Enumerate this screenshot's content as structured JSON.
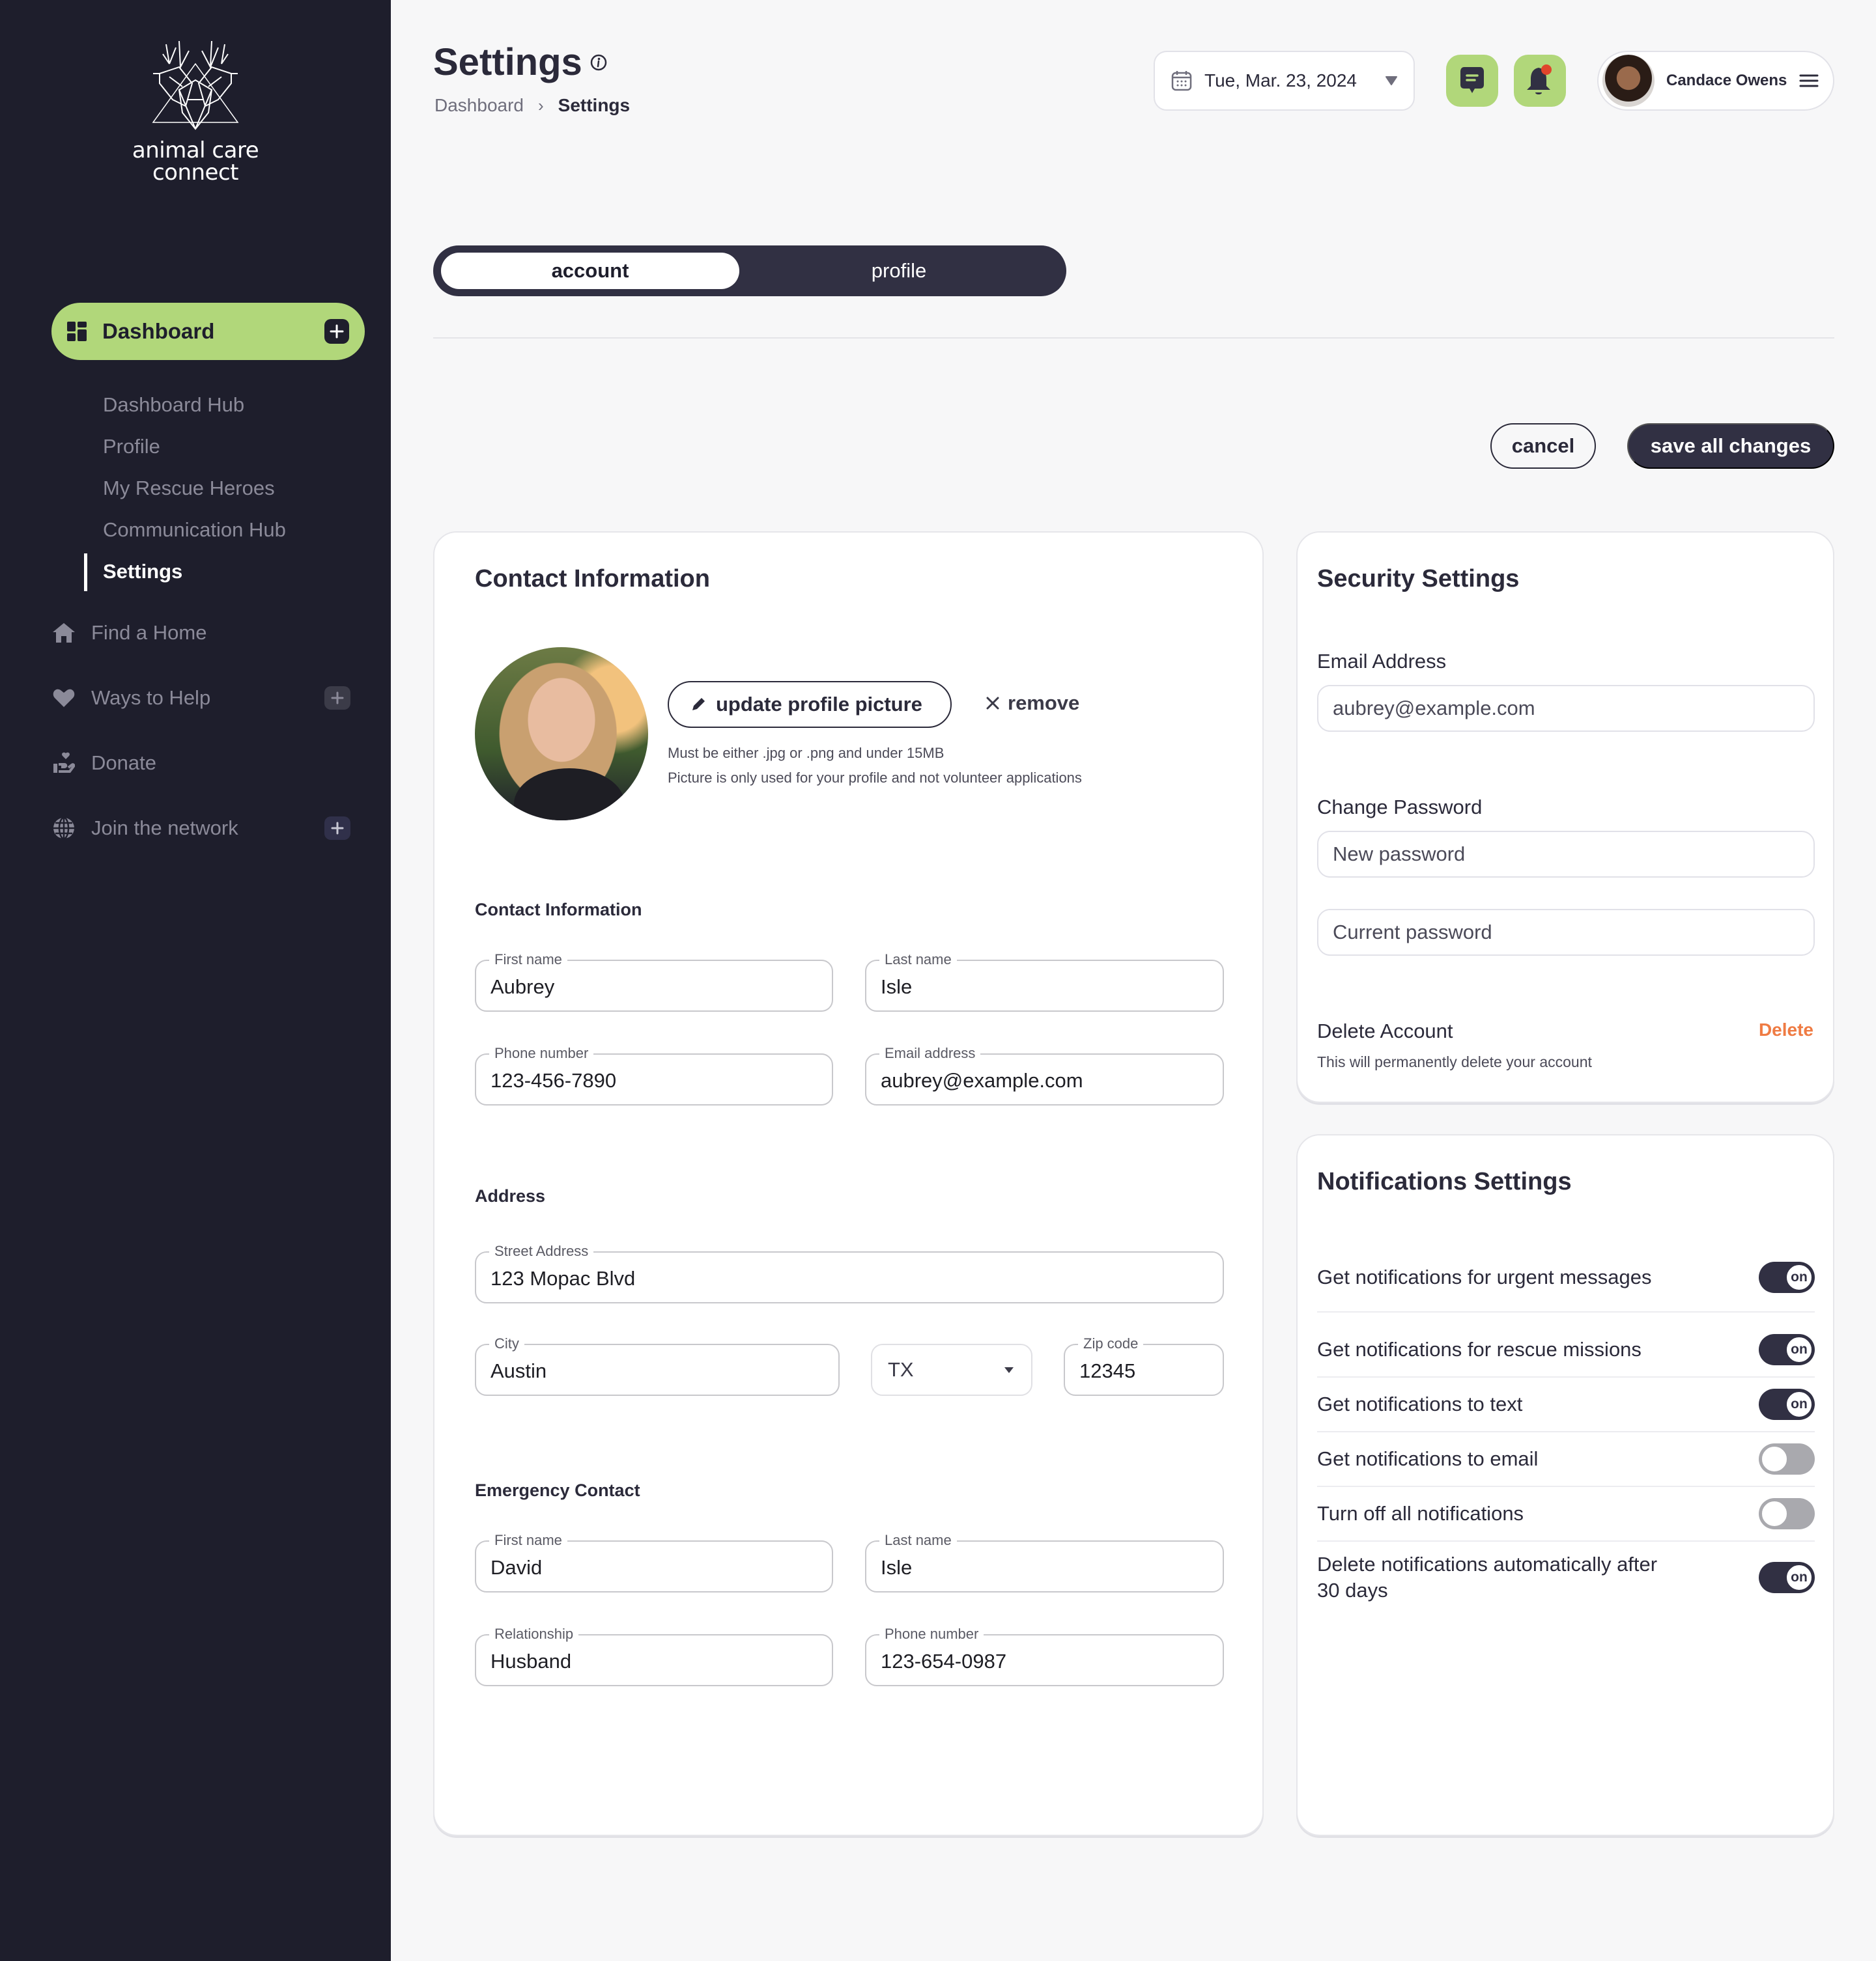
{
  "brand": {
    "line1": "animal care",
    "line2": "connect"
  },
  "sidebar": {
    "dashboard_label": "Dashboard",
    "sub_items": [
      {
        "label": "Dashboard Hub",
        "active": false
      },
      {
        "label": "Profile",
        "active": false
      },
      {
        "label": "My Rescue Heroes",
        "active": false
      },
      {
        "label": "Communication Hub",
        "active": false
      },
      {
        "label": "Settings",
        "active": true
      }
    ],
    "items": [
      {
        "label": "Find a Home",
        "icon": "home-icon",
        "expandable": false
      },
      {
        "label": "Ways to Help",
        "icon": "heart-icon",
        "expandable": true
      },
      {
        "label": "Donate",
        "icon": "donate-hand-icon",
        "expandable": false
      },
      {
        "label": "Join the network",
        "icon": "globe-icon",
        "expandable": true
      }
    ]
  },
  "header": {
    "title": "Settings",
    "breadcrumb": [
      "Dashboard",
      "Settings"
    ],
    "date": "Tue, Mar. 23, 2024",
    "user_name": "Candace Owens",
    "has_notification": true
  },
  "tabs": [
    {
      "label": "account",
      "active": true
    },
    {
      "label": "profile",
      "active": false
    }
  ],
  "actions": {
    "cancel": "cancel",
    "save": "save all changes"
  },
  "contact_card": {
    "title": "Contact Information",
    "update_picture": "update profile picture",
    "remove": "remove",
    "hint1": "Must be either .jpg or .png and under 15MB",
    "hint2": "Picture is only used for your profile and not volunteer applications",
    "contact_section": "Contact Information",
    "first_name": {
      "label": "First name",
      "value": "Aubrey"
    },
    "last_name": {
      "label": "Last name",
      "value": "Isle"
    },
    "phone": {
      "label": "Phone number",
      "value": "123-456-7890"
    },
    "email": {
      "label": "Email address",
      "value": "aubrey@example.com"
    },
    "address_section": "Address",
    "street": {
      "label": "Street Address",
      "value": "123 Mopac Blvd"
    },
    "city": {
      "label": "City",
      "value": "Austin"
    },
    "state": {
      "value": "TX"
    },
    "zip": {
      "label": "Zip code",
      "value": "12345"
    },
    "emergency_section": "Emergency Contact",
    "em_first_name": {
      "label": "First name",
      "value": "David"
    },
    "em_last_name": {
      "label": "Last name",
      "value": "Isle"
    },
    "em_relationship": {
      "label": "Relationship",
      "value": "Husband"
    },
    "em_phone": {
      "label": "Phone number",
      "value": "123-654-0987"
    }
  },
  "security_card": {
    "title": "Security Settings",
    "email_label": "Email Address",
    "email_value": "aubrey@example.com",
    "password_label": "Change Password",
    "new_password_placeholder": "New password",
    "current_password_placeholder": "Current password",
    "delete_label": "Delete Account",
    "delete_link": "Delete",
    "delete_hint": "This will permanently delete your account"
  },
  "notifications_card": {
    "title": "Notifications Settings",
    "on_text": "on",
    "items": [
      {
        "label": "Get notifications for urgent messages",
        "on": true
      },
      {
        "label": "Get notifications for rescue missions",
        "on": true
      },
      {
        "label": "Get notifications to text",
        "on": true
      },
      {
        "label": "Get notifications to email",
        "on": false
      },
      {
        "label": "Turn off all notifications",
        "on": false
      },
      {
        "label": "Delete notifications automatically after 30 days",
        "on": true
      }
    ]
  },
  "colors": {
    "sidebar_bg": "#1e1e2c",
    "accent_green": "#b1d77a",
    "dark_primary": "#313043",
    "danger_orange": "#ef7b43",
    "notification_dot": "#e0452b"
  }
}
